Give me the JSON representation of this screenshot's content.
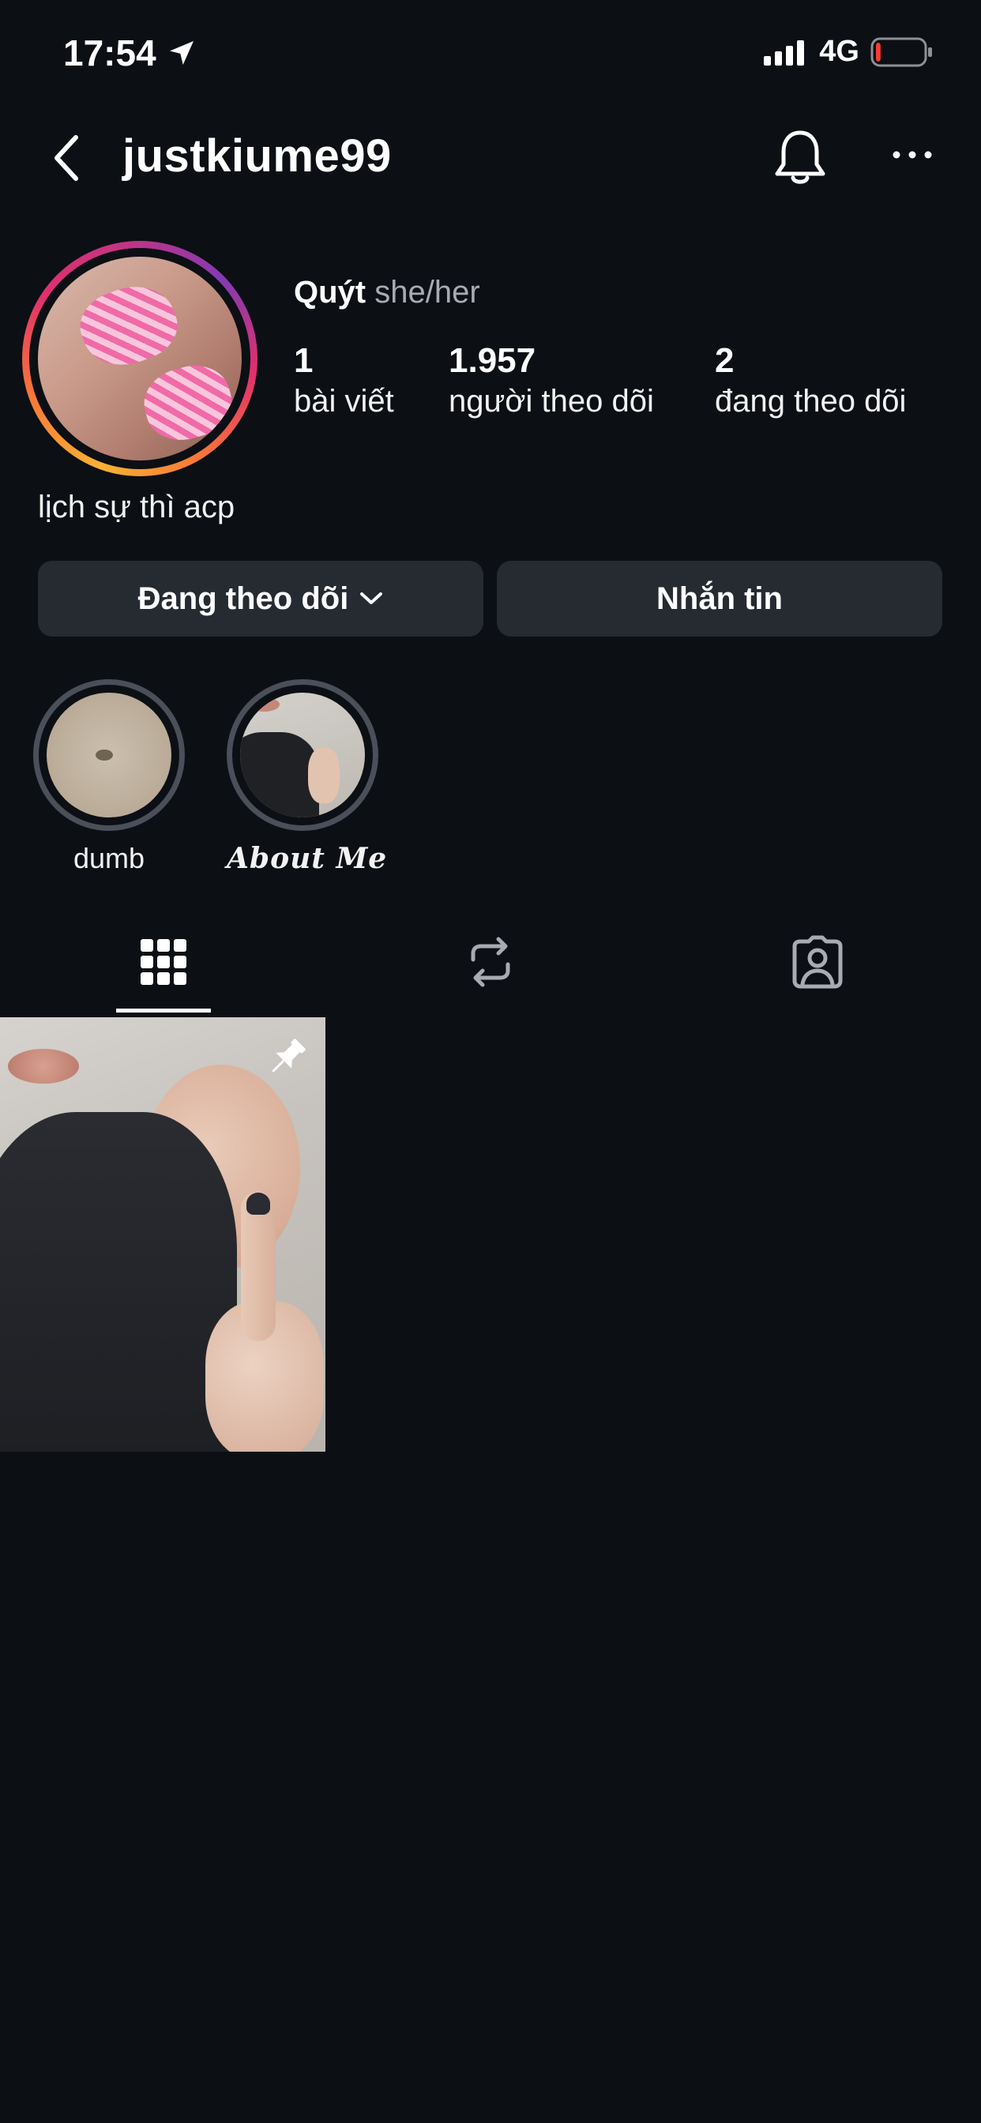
{
  "status_bar": {
    "time": "17:54",
    "network": "4G",
    "battery_level_fraction": 0.1,
    "battery_color": "#ff3b30"
  },
  "header": {
    "username": "justkiume99",
    "icons": [
      "chevron-left-icon",
      "bell-icon",
      "more-horizontal-icon"
    ]
  },
  "profile": {
    "display_name": "Quýt",
    "pronouns": "she/her",
    "bio": "lịch sự thì acp",
    "stats": [
      {
        "number": "1",
        "label": "bài viết"
      },
      {
        "number": "1.957",
        "label": "người theo dõi"
      },
      {
        "number": "2",
        "label": "đang theo dõi"
      }
    ],
    "story_ring_colors": [
      "#f9b233",
      "#f77737",
      "#e1306c",
      "#c13584",
      "#833ab4"
    ]
  },
  "actions": {
    "following_label": "Đang theo dõi",
    "message_label": "Nhắn tin"
  },
  "highlights": [
    {
      "label": "dumb"
    },
    {
      "label": "𝑨𝒃𝒐𝒖𝒕 𝑴𝒆"
    }
  ],
  "tabs": [
    {
      "icon": "grid-icon",
      "active": true
    },
    {
      "icon": "reels-repost-icon",
      "active": false
    },
    {
      "icon": "tagged-person-icon",
      "active": false
    }
  ],
  "posts": [
    {
      "pinned": true,
      "icon": "pin-icon"
    }
  ],
  "colors": {
    "background": "#0c0f14",
    "button_bg": "#262a31",
    "secondary_text": "#a8abb2"
  }
}
